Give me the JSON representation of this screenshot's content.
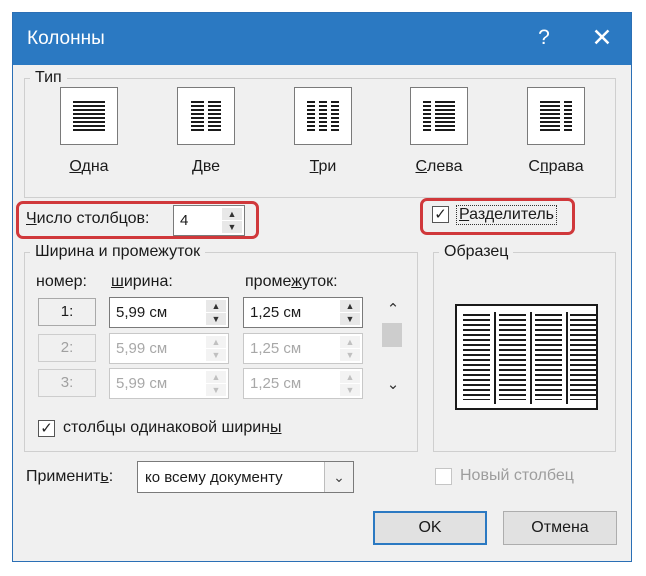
{
  "dialog": {
    "title": "Колонны",
    "help_icon": "?",
    "close_icon": "✕"
  },
  "type_group": {
    "title": "Тип",
    "presets": [
      {
        "label": "Одна",
        "underline": "О",
        "rest": "дна"
      },
      {
        "label": "Две",
        "underline": "Д",
        "rest": "ве"
      },
      {
        "label": "Три",
        "underline": "Т",
        "rest": "ри"
      },
      {
        "label": "Слева",
        "underline": "С",
        "rest": "лева"
      },
      {
        "label": "Справа",
        "underline": "п",
        "pre": "С",
        "rest": "рава"
      }
    ]
  },
  "columns_count": {
    "label_ul": "Ч",
    "label_rest": "исло столбцов:",
    "value": "4"
  },
  "divider": {
    "label_ul": "Р",
    "label_rest": "азделитель",
    "checked": true
  },
  "width_group": {
    "title": "Ширина и промежуток",
    "col_number": "номер:",
    "col_width_pre": "",
    "col_width_ul": "ш",
    "col_width_rest": "ирина:",
    "col_spacing_pre": "проме",
    "col_spacing_ul": "ж",
    "col_spacing_rest": "уток:",
    "rows": [
      {
        "number": "1:",
        "width": "5,99 см",
        "spacing": "1,25 см",
        "enabled": true
      },
      {
        "number": "2:",
        "width": "5,99 см",
        "spacing": "1,25 см",
        "enabled": false
      },
      {
        "number": "3:",
        "width": "5,99 см",
        "spacing": "1,25 см",
        "enabled": false
      }
    ],
    "equal_width_pre": "столбцы одинаковой ширин",
    "equal_width_ul": "ы",
    "equal_width_checked": true
  },
  "sample": {
    "title": "Образец",
    "columns": 4
  },
  "apply": {
    "label_pre": "Применит",
    "label_ul": "ь",
    "label_post": ":",
    "value": "ко всему документу"
  },
  "new_column": {
    "label": "Новый столбец",
    "checked": false,
    "enabled": false
  },
  "buttons": {
    "ok": "OK",
    "cancel": "Отмена"
  }
}
